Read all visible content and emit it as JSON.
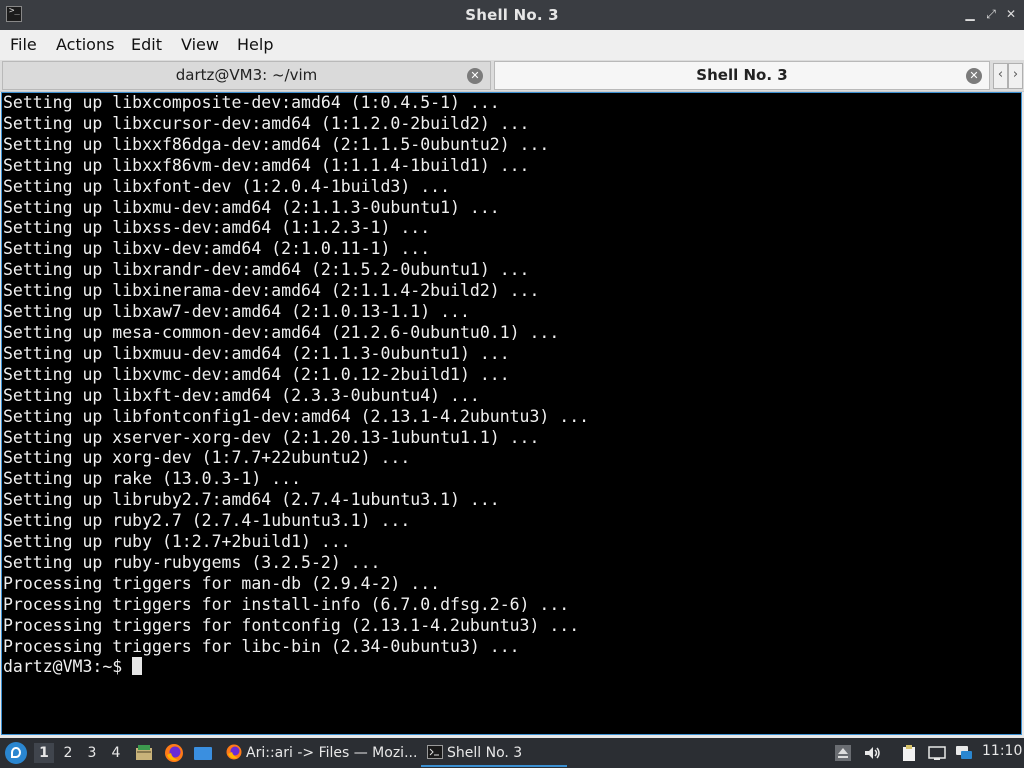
{
  "window": {
    "title": "Shell No. 3",
    "app_icon": ">_"
  },
  "menubar": {
    "items": [
      "File",
      "Actions",
      "Edit",
      "View",
      "Help"
    ]
  },
  "tabs": [
    {
      "label": "dartz@VM3: ~/vim",
      "active": false
    },
    {
      "label": "Shell No. 3",
      "active": true
    }
  ],
  "terminal": {
    "lines": [
      "Setting up libxcomposite-dev:amd64 (1:0.4.5-1) ...",
      "Setting up libxcursor-dev:amd64 (1:1.2.0-2build2) ...",
      "Setting up libxxf86dga-dev:amd64 (2:1.1.5-0ubuntu2) ...",
      "Setting up libxxf86vm-dev:amd64 (1:1.1.4-1build1) ...",
      "Setting up libxfont-dev (1:2.0.4-1build3) ...",
      "Setting up libxmu-dev:amd64 (2:1.1.3-0ubuntu1) ...",
      "Setting up libxss-dev:amd64 (1:1.2.3-1) ...",
      "Setting up libxv-dev:amd64 (2:1.0.11-1) ...",
      "Setting up libxrandr-dev:amd64 (2:1.5.2-0ubuntu1) ...",
      "Setting up libxinerama-dev:amd64 (2:1.1.4-2build2) ...",
      "Setting up libxaw7-dev:amd64 (2:1.0.13-1.1) ...",
      "Setting up mesa-common-dev:amd64 (21.2.6-0ubuntu0.1) ...",
      "Setting up libxmuu-dev:amd64 (2:1.1.3-0ubuntu1) ...",
      "Setting up libxvmc-dev:amd64 (2:1.0.12-2build1) ...",
      "Setting up libxft-dev:amd64 (2.3.3-0ubuntu4) ...",
      "Setting up libfontconfig1-dev:amd64 (2.13.1-4.2ubuntu3) ...",
      "Setting up xserver-xorg-dev (2:1.20.13-1ubuntu1.1) ...",
      "Setting up xorg-dev (1:7.7+22ubuntu2) ...",
      "Setting up rake (13.0.3-1) ...",
      "Setting up libruby2.7:amd64 (2.7.4-1ubuntu3.1) ...",
      "Setting up ruby2.7 (2.7.4-1ubuntu3.1) ...",
      "Setting up ruby (1:2.7+2build1) ...",
      "Setting up ruby-rubygems (3.2.5-2) ...",
      "Processing triggers for man-db (2.9.4-2) ...",
      "Processing triggers for install-info (6.7.0.dfsg.2-6) ...",
      "Processing triggers for fontconfig (2.13.1-4.2ubuntu3) ...",
      "Processing triggers for libc-bin (2.34-0ubuntu3) ..."
    ],
    "prompt": "dartz@VM3:~$ "
  },
  "taskbar": {
    "workspaces": [
      "1",
      "2",
      "3",
      "4"
    ],
    "active_workspace": "1",
    "quicklaunch_icons": [
      "file-manager-icon",
      "firefox-icon",
      "desktop-icon"
    ],
    "tasks": [
      {
        "label": "Ari::ari -> Files — Mozi...",
        "icon": "firefox-icon",
        "active": false
      },
      {
        "label": "Shell No. 3",
        "icon": "terminal-icon",
        "active": true
      }
    ],
    "tray_icons": [
      "eject-icon",
      "volume-icon",
      "clipboard-icon",
      "network-icon",
      "chat-icon"
    ],
    "clock": "11:10"
  },
  "colors": {
    "accent": "#3b8fd1",
    "terminal_bg": "#000000",
    "terminal_fg": "#f0f0f0",
    "titlebar": "#3a3d42",
    "taskbar": "#2b2e33"
  }
}
